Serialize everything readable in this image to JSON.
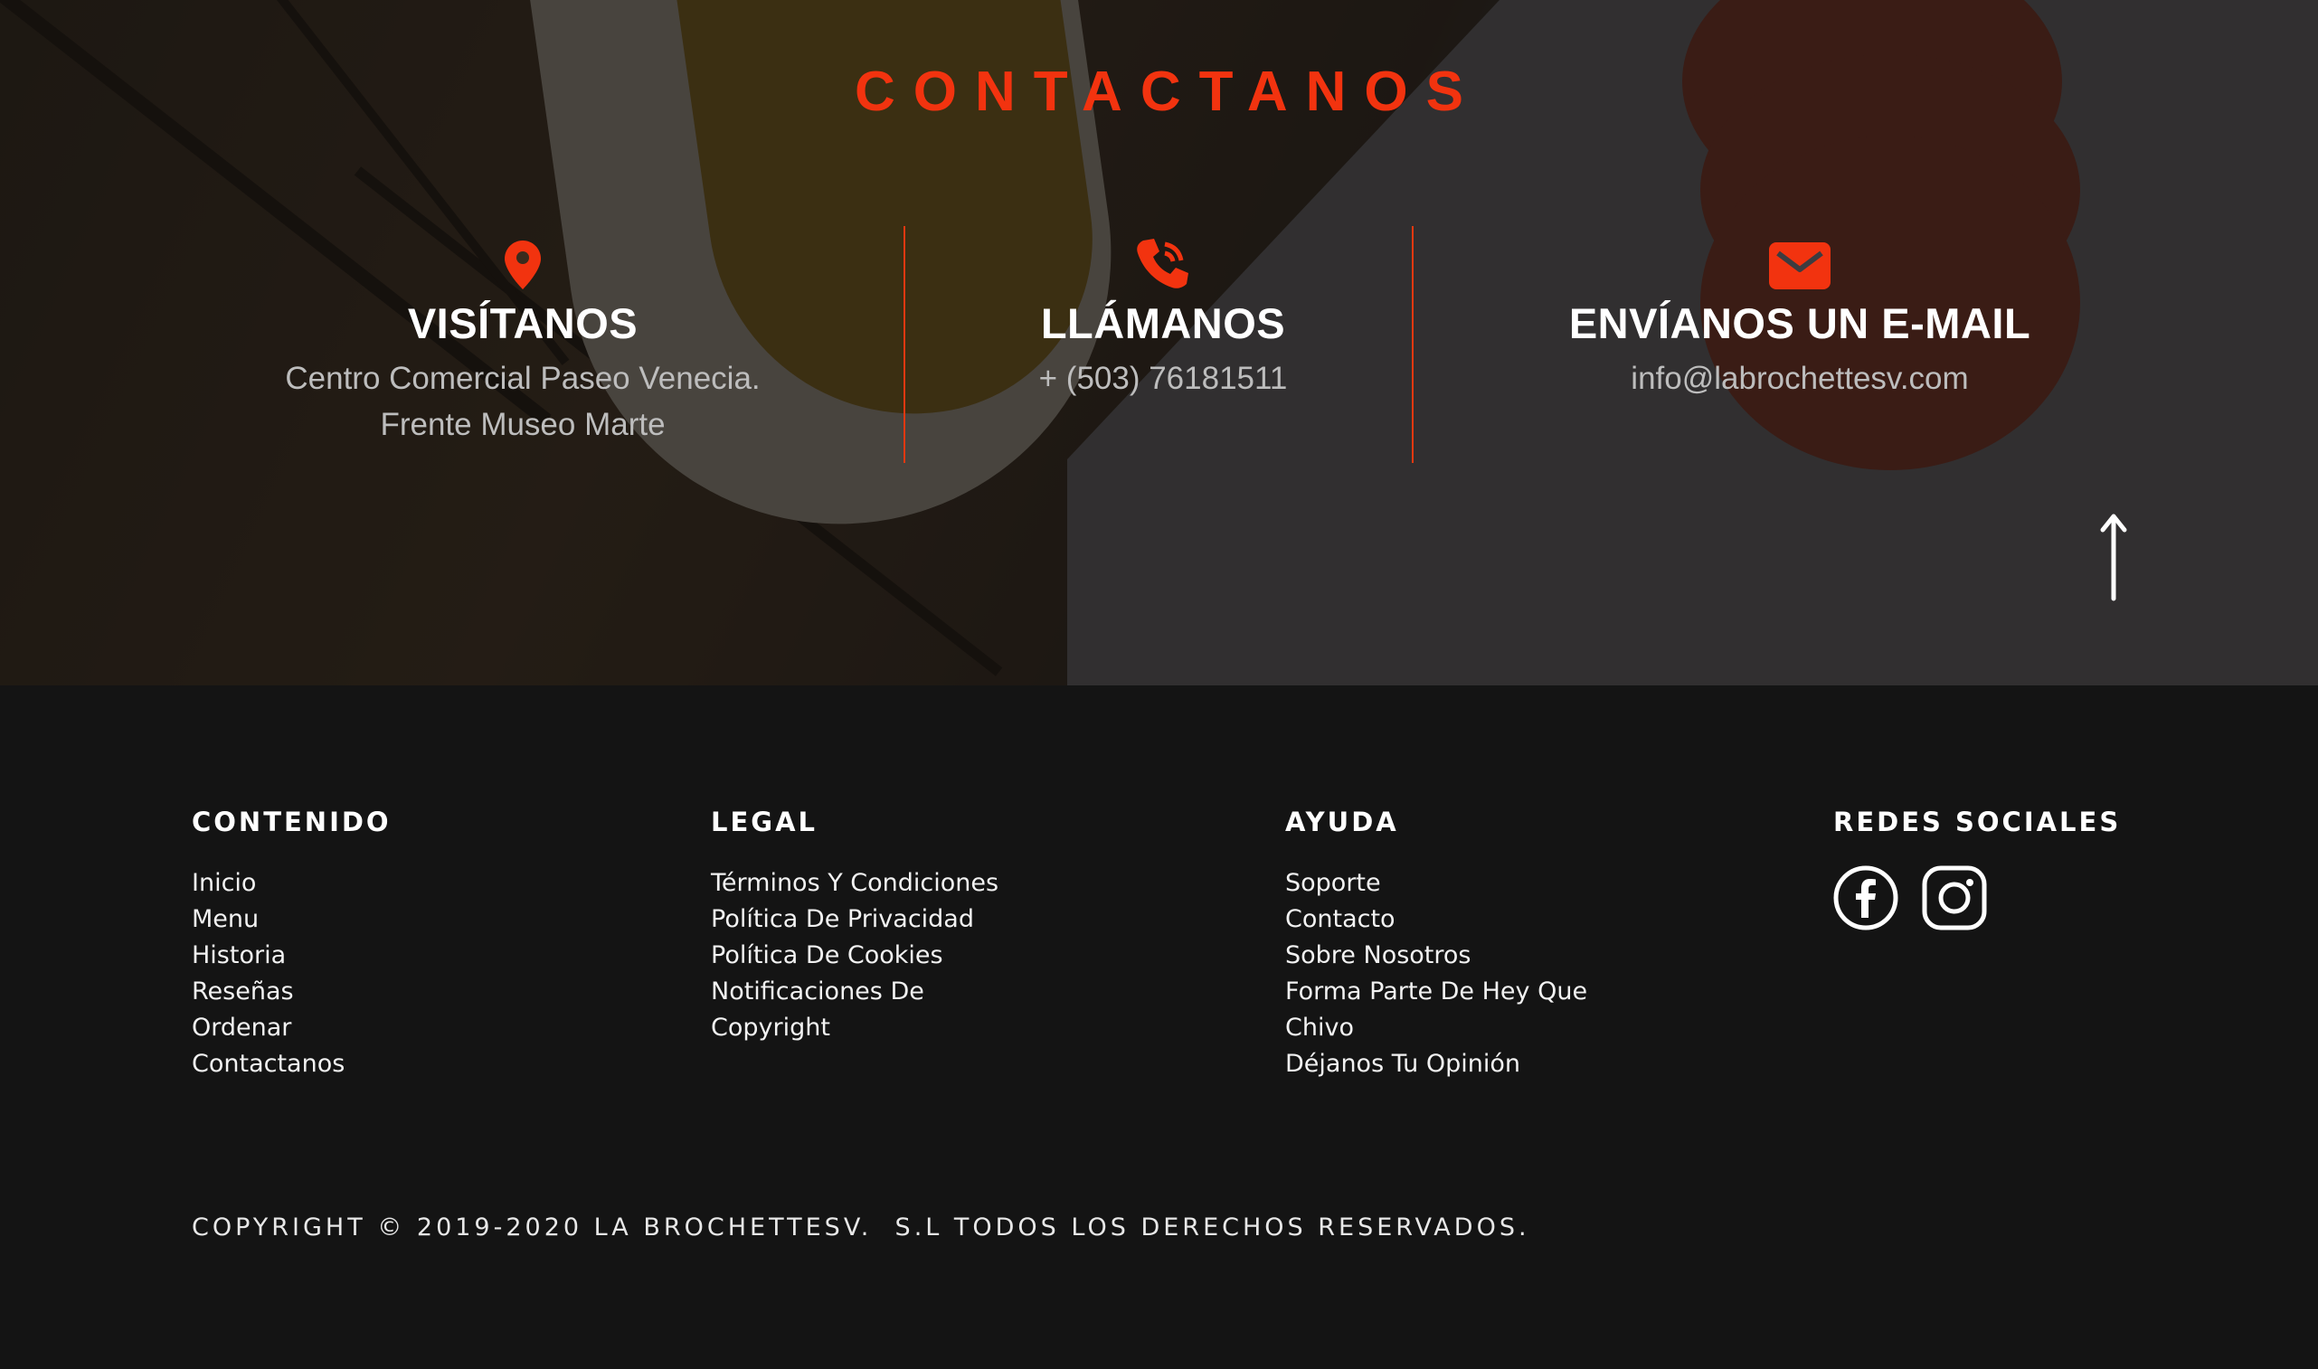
{
  "contact": {
    "title": "CONTACTANOS",
    "accent_color": "#f2330f",
    "columns": [
      {
        "icon": "location-pin-icon",
        "heading": "VISÍTANOS",
        "lines": [
          "Centro Comercial Paseo Venecia.",
          "Frente Museo Marte"
        ]
      },
      {
        "icon": "phone-icon",
        "heading": "LLÁMANOS",
        "lines": [
          "+ (503) 76181511"
        ]
      },
      {
        "icon": "envelope-icon",
        "heading": "ENVÍANOS UN E-MAIL",
        "lines": [
          "info@labrochettesv.com"
        ]
      }
    ],
    "scroll_top_icon": "arrow-up-icon"
  },
  "footer": {
    "contenido": {
      "title": "CONTENIDO",
      "links": [
        "Inicio",
        "Menu",
        "Historia",
        "Reseñas",
        "Ordenar",
        "Contactanos"
      ]
    },
    "legal": {
      "title": "LEGAL",
      "links": [
        "Términos Y Condiciones",
        "Política De Privacidad",
        "Política De Cookies",
        "Notificaciones De",
        "Copyright"
      ]
    },
    "ayuda": {
      "title": "AYUDA",
      "links": [
        "Soporte",
        "Contacto",
        "Sobre Nosotros",
        "Forma Parte De Hey Que",
        "Chivo",
        "Déjanos Tu Opinión"
      ]
    },
    "redes": {
      "title": "REDES SOCIALES",
      "icons": [
        "facebook-icon",
        "instagram-icon"
      ]
    },
    "copyright": "COPYRIGHT © 2019-2020 LA BROCHETTESV.  S.L TODOS LOS DERECHOS RESERVADOS."
  }
}
